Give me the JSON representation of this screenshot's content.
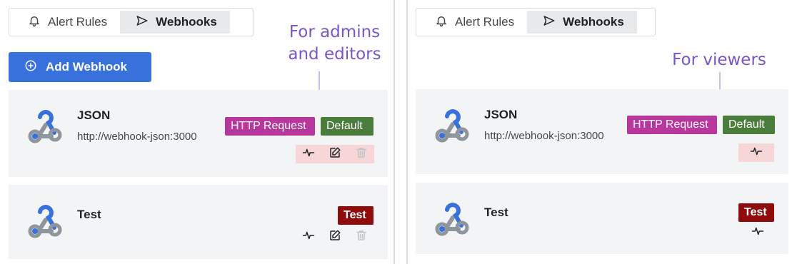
{
  "panels": [
    {
      "tabs": [
        {
          "label": "Alert Rules",
          "icon": "bell-icon",
          "active": false
        },
        {
          "label": "Webhooks",
          "icon": "send-icon",
          "active": true
        }
      ],
      "add_button": {
        "label": "Add Webhook",
        "icon": "plus-circle-icon"
      },
      "annotation": "For admins\nand editors",
      "webhooks": [
        {
          "name": "JSON",
          "url": "http://webhook-json:3000",
          "badges": [
            "HTTP Request",
            "Default"
          ],
          "actions": [
            "test-icon",
            "edit-icon",
            "delete-icon"
          ]
        },
        {
          "name": "Test",
          "url": "",
          "badges": [
            "Test"
          ],
          "actions": [
            "test-icon",
            "edit-icon",
            "delete-icon"
          ]
        }
      ]
    },
    {
      "tabs": [
        {
          "label": "Alert Rules",
          "icon": "bell-icon",
          "active": false
        },
        {
          "label": "Webhooks",
          "icon": "send-icon",
          "active": true
        }
      ],
      "annotation": "For viewers",
      "webhooks": [
        {
          "name": "JSON",
          "url": "http://webhook-json:3000",
          "badges": [
            "HTTP Request",
            "Default"
          ],
          "actions": [
            "test-icon"
          ]
        },
        {
          "name": "Test",
          "url": "",
          "badges": [
            "Test"
          ],
          "actions": [
            "test-icon"
          ]
        }
      ]
    }
  ],
  "colors": {
    "primary": "#3871dc",
    "http_badge": "#b8379c",
    "default_badge": "#4a7c3b",
    "test_badge": "#900c0c",
    "annotation": "#7a55c7",
    "highlight": "#f6d6d6"
  }
}
